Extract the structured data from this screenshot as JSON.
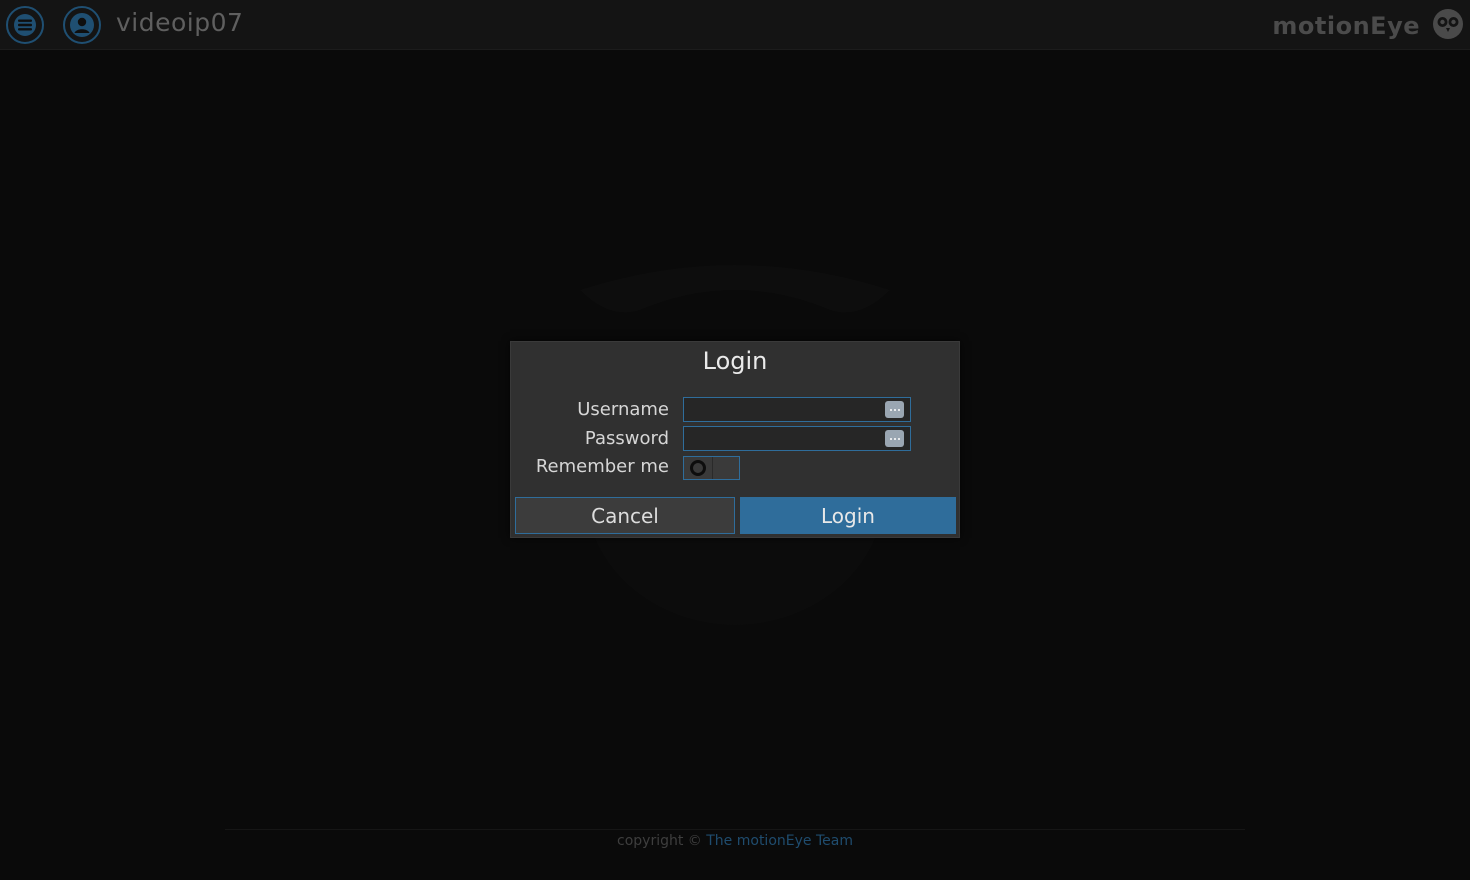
{
  "header": {
    "camera_name": "videoip07",
    "brand": "motionEye",
    "menu_icon": "hamburger-menu-icon",
    "user_icon": "user-icon",
    "logo_icon": "owl-logo-icon"
  },
  "login_dialog": {
    "title": "Login",
    "username_label": "Username",
    "username_value": "",
    "password_label": "Password",
    "password_value": "",
    "remember_label": "Remember me",
    "remember_checked": false,
    "cancel_label": "Cancel",
    "login_label": "Login"
  },
  "footer": {
    "copyright_text": "copyright ©",
    "team_link": "The motionEye Team"
  },
  "colors": {
    "accent": "#2f6d9b",
    "background": "#0a0a0a",
    "dialog_bg": "#303030"
  }
}
